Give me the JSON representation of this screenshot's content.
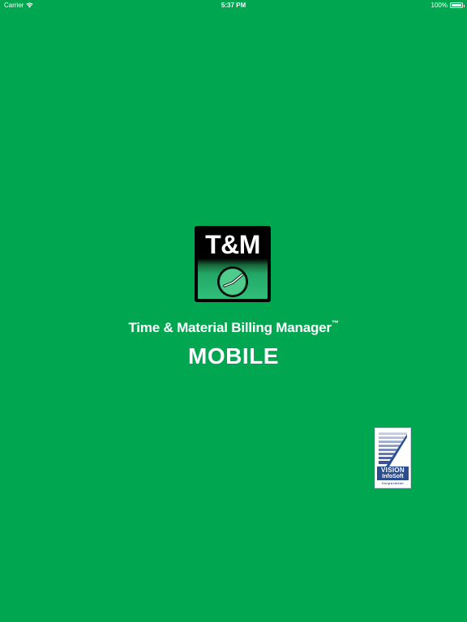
{
  "status_bar": {
    "carrier": "Carrier",
    "time": "5:37 PM",
    "battery": "100%",
    "wifi_icon": "wifi-icon",
    "battery_icon": "battery-icon"
  },
  "logo": {
    "text": "T&M",
    "icon": "clock-icon"
  },
  "title": {
    "text": "Time & Material Billing Manager",
    "trademark": "™"
  },
  "subtitle": "MOBILE",
  "company": {
    "line1": "VISION",
    "line2": "InfoSoft",
    "line3": "Corporation",
    "brand_color": "#2a4d8f"
  },
  "colors": {
    "background": "#00a650",
    "text": "#ffffff"
  }
}
